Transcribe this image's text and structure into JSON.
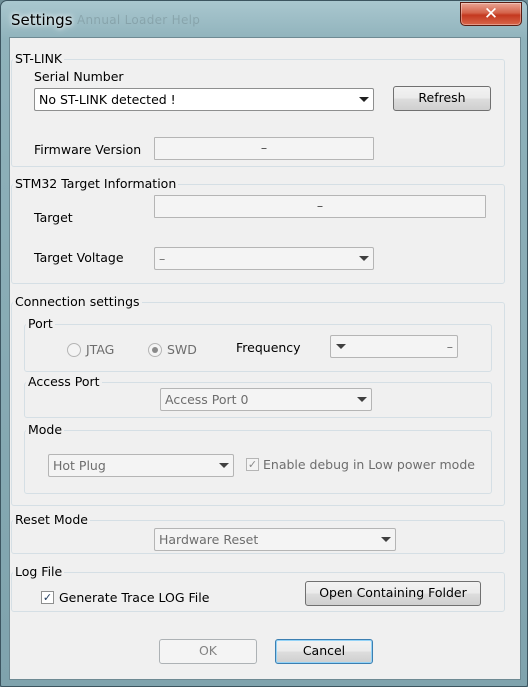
{
  "window": {
    "title": "Settings",
    "ghost_menu": "Annual Loader   Help"
  },
  "icons": {
    "close": "close-x-icon",
    "dropdown": "chevron-down-icon",
    "check": "checkmark-icon"
  },
  "stlink": {
    "group_title": "ST-LINK",
    "serial_label": "Serial Number",
    "serial_value": "No ST-LINK detected !",
    "refresh_label": "Refresh",
    "firmware_label": "Firmware Version",
    "firmware_value": "–"
  },
  "target": {
    "group_title": "STM32 Target Information",
    "target_label": "Target",
    "target_value": "–",
    "voltage_label": "Target Voltage",
    "voltage_value": "–"
  },
  "connection": {
    "group_title": "Connection settings",
    "port_title": "Port",
    "jtag_label": "JTAG",
    "swd_label": "SWD",
    "selected_port": "SWD",
    "frequency_label": "Frequency",
    "frequency_value": "–",
    "access_port_title": "Access Port",
    "access_port_value": "Access Port 0",
    "mode_title": "Mode",
    "mode_value": "Hot Plug",
    "low_power_label": "Enable debug in Low power mode",
    "low_power_checked": true
  },
  "reset": {
    "group_title": "Reset Mode",
    "value": "Hardware Reset"
  },
  "log": {
    "group_title": "Log File",
    "generate_label": "Generate Trace LOG File",
    "generate_checked": true,
    "open_folder_label": "Open Containing Folder"
  },
  "footer": {
    "ok_label": "OK",
    "cancel_label": "Cancel"
  }
}
